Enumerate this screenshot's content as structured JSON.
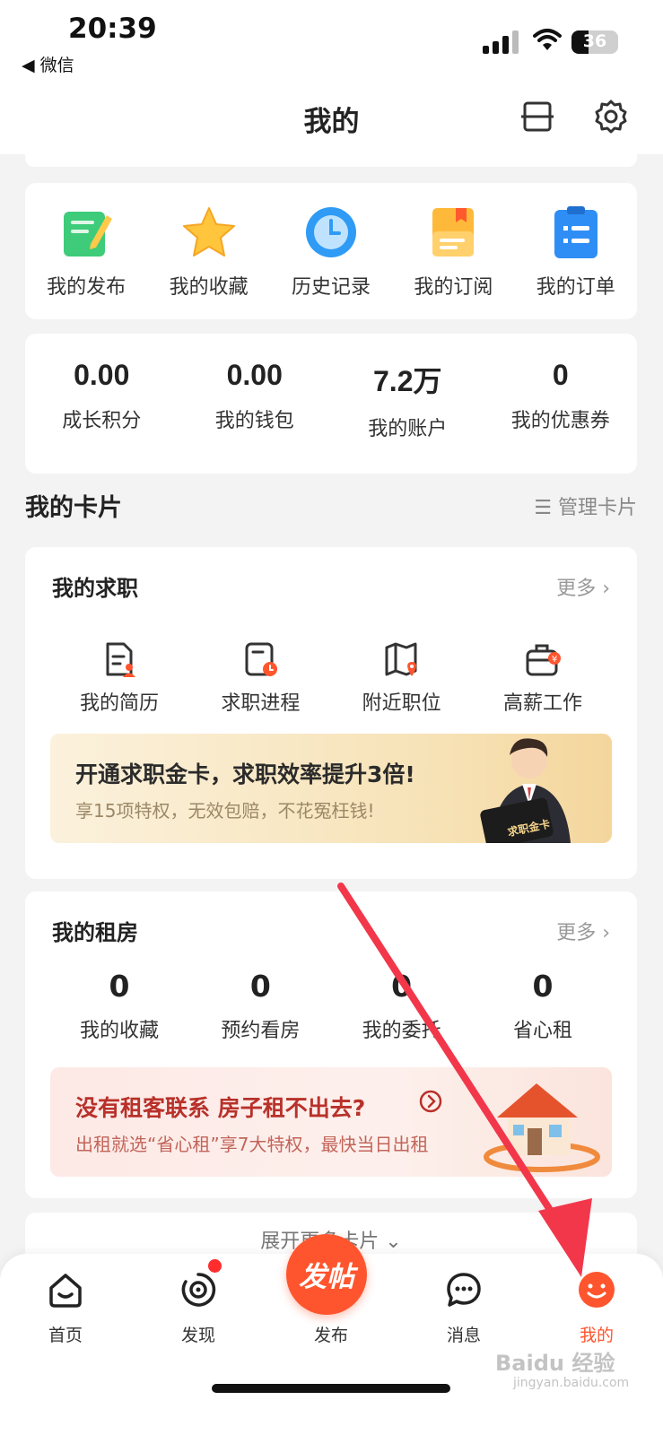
{
  "status_bar": {
    "time": "20:39",
    "back_app": "◀ 微信",
    "battery": "36",
    "battery_level": 0.36
  },
  "nav": {
    "title": "我的",
    "icons": [
      "scan-icon",
      "gear-icon"
    ]
  },
  "quick_actions": [
    {
      "label": "我的发布",
      "icon": "edit-note-icon"
    },
    {
      "label": "我的收藏",
      "icon": "star-icon"
    },
    {
      "label": "历史记录",
      "icon": "clock-icon"
    },
    {
      "label": "我的订阅",
      "icon": "bookmark-doc-icon"
    },
    {
      "label": "我的订单",
      "icon": "clipboard-list-icon"
    }
  ],
  "stats": [
    {
      "value": "0.00",
      "label": "成长积分"
    },
    {
      "value": "0.00",
      "label": "我的钱包"
    },
    {
      "value": "7.2万",
      "label": "我的账户"
    },
    {
      "value": "0",
      "label": "我的优惠券"
    }
  ],
  "cards_section": {
    "title": "我的卡片",
    "manage_label": "管理卡片"
  },
  "job_card": {
    "title": "我的求职",
    "more": "更多 ›",
    "items": [
      {
        "label": "我的简历",
        "icon": "resume-icon"
      },
      {
        "label": "求职进程",
        "icon": "progress-clock-icon"
      },
      {
        "label": "附近职位",
        "icon": "map-pin-icon"
      },
      {
        "label": "高薪工作",
        "icon": "briefcase-icon"
      }
    ],
    "banner": {
      "title": "开通求职金卡，求职效率提升3倍!",
      "subtitle": "享15项特权，无效包赔，不花冤枉钱!",
      "card_text": "求职金卡"
    }
  },
  "rent_card": {
    "title": "我的租房",
    "more": "更多 ›",
    "stats": [
      {
        "value": "0",
        "label": "我的收藏"
      },
      {
        "value": "0",
        "label": "预约看房"
      },
      {
        "value": "0",
        "label": "我的委托"
      },
      {
        "value": "0",
        "label": "省心租"
      }
    ],
    "banner": {
      "title": "没有租客联系 房子租不出去?",
      "subtitle": "出租就选“省心租”享7大特权，最快当日出租"
    }
  },
  "expand": {
    "label": "展开更多卡片 ⌄"
  },
  "tabbar": {
    "tabs": [
      {
        "label": "首页",
        "icon": "home-icon"
      },
      {
        "label": "发现",
        "icon": "discover-icon"
      },
      {
        "label": "发布",
        "icon": "post-icon"
      },
      {
        "label": "消息",
        "icon": "message-icon"
      },
      {
        "label": "我的",
        "icon": "profile-smile-icon"
      }
    ],
    "post_button": "发帖",
    "active_color": "#ff552e"
  },
  "colors": {
    "accent": "#ff552e",
    "annotation_arrow": "#f2374b"
  },
  "watermark": {
    "text": "Baidu 经验",
    "sub": "jingyan.baidu.com"
  }
}
